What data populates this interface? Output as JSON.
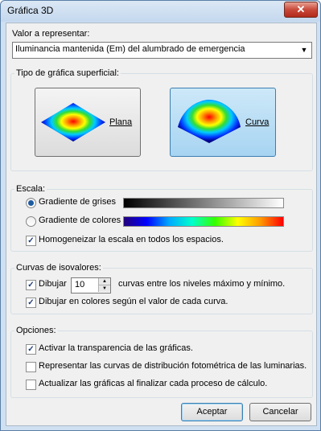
{
  "window": {
    "title": "Gráfica 3D",
    "close_glyph": "✕"
  },
  "value": {
    "label": "Valor a representar:",
    "selected": "Iluminancia mantenida (Em) del alumbrado de emergencia"
  },
  "surface": {
    "label": "Tipo de gráfica superficial:",
    "plane_label": "Plana",
    "curve_label": "Curva",
    "selected": "Curva"
  },
  "scale": {
    "label": "Escala:",
    "gray_label": "Gradiente de grises",
    "color_label": "Gradiente de colores",
    "selected": "Gradiente de grises",
    "homog_label": "Homogeneizar la escala en todos los espacios.",
    "homog_checked": true
  },
  "isolines": {
    "label": "Curvas de isovalores:",
    "draw_label": "Dibujar",
    "draw_checked": true,
    "count": "10",
    "suffix": "curvas entre los niveles máximo y mínimo.",
    "colors_label": "Dibujar en colores según el valor de cada curva.",
    "colors_checked": true
  },
  "options": {
    "label": "Opciones:",
    "items": [
      {
        "label": "Activar la transparencia de las gráficas.",
        "checked": true
      },
      {
        "label": "Representar las curvas de distribución fotométrica de las luminarias.",
        "checked": false
      },
      {
        "label": "Actualizar las gráficas al finalizar cada proceso de cálculo.",
        "checked": false
      }
    ]
  },
  "buttons": {
    "accept": "Aceptar",
    "cancel": "Cancelar"
  },
  "colors": {
    "selected_button": "#a7d4f2",
    "accent": "#1d5ba0"
  }
}
